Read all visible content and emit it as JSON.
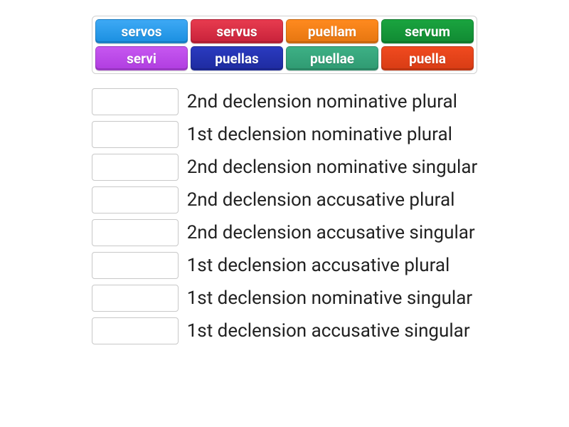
{
  "tiles": {
    "row1": [
      {
        "label": "servos",
        "color": "blue"
      },
      {
        "label": "servus",
        "color": "red"
      },
      {
        "label": "puellam",
        "color": "orange"
      },
      {
        "label": "servum",
        "color": "green"
      }
    ],
    "row2": [
      {
        "label": "servi",
        "color": "magenta"
      },
      {
        "label": "puellas",
        "color": "indigo"
      },
      {
        "label": "puellae",
        "color": "teal"
      },
      {
        "label": "puella",
        "color": "redorange"
      }
    ]
  },
  "answers": [
    {
      "label": "2nd declension nominative plural"
    },
    {
      "label": "1st declension nominative plural"
    },
    {
      "label": "2nd declension nominative singular"
    },
    {
      "label": "2nd declension accusative plural"
    },
    {
      "label": "2nd declension accusative singular"
    },
    {
      "label": "1st declension accusative plural"
    },
    {
      "label": "1st declension nominative singular"
    },
    {
      "label": "1st declension accusative singular"
    }
  ]
}
